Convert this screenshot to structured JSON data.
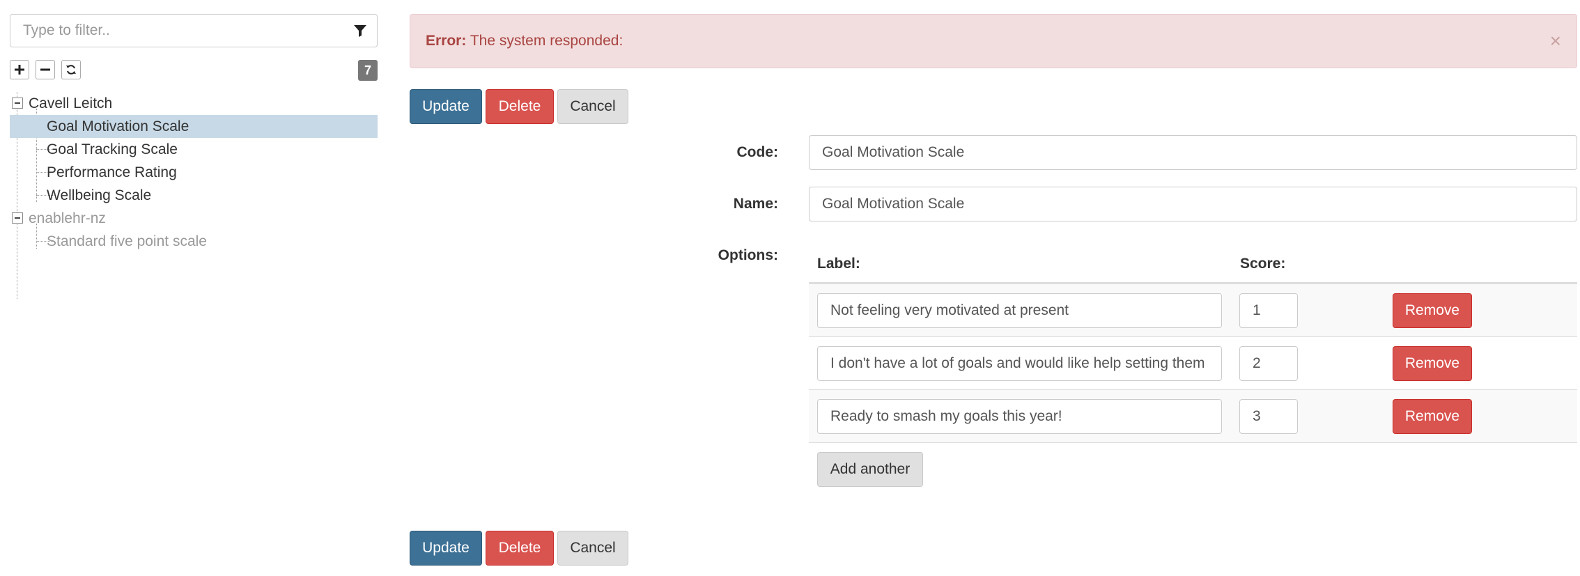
{
  "sidebar": {
    "filter_placeholder": "Type to filter..",
    "count": "7",
    "tree": {
      "groups": [
        {
          "label": "Cavell Leitch",
          "items": [
            "Goal Motivation Scale",
            "Goal Tracking Scale",
            "Performance Rating",
            "Wellbeing Scale"
          ]
        },
        {
          "label": "enablehr-nz",
          "items": [
            "Standard five point scale"
          ]
        }
      ],
      "selected": "Goal Motivation Scale"
    }
  },
  "alert": {
    "prefix": "Error:",
    "message": "The system responded:",
    "close": "×"
  },
  "actions": {
    "update": "Update",
    "delete": "Delete",
    "cancel": "Cancel"
  },
  "form": {
    "code_label": "Code:",
    "code_value": "Goal Motivation Scale",
    "name_label": "Name:",
    "name_value": "Goal Motivation Scale",
    "options_label": "Options:",
    "options": {
      "label_header": "Label:",
      "score_header": "Score:",
      "rows": [
        {
          "label": "Not feeling very motivated at present",
          "score": "1",
          "remove": "Remove"
        },
        {
          "label": "I don't have a lot of goals and would like help setting them",
          "score": "2",
          "remove": "Remove"
        },
        {
          "label": "Ready to smash my goals this year!",
          "score": "3",
          "remove": "Remove"
        }
      ],
      "add_another": "Add another"
    }
  }
}
